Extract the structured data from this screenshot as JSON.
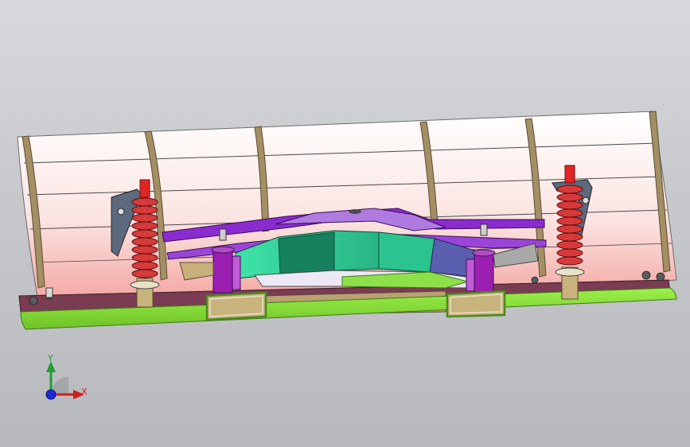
{
  "scene": {
    "colors": {
      "background_top": "#d7d9dd",
      "background_bottom": "#b7b9bd",
      "blade_top": "#ffffff",
      "blade_bottom": "#f4aaa7",
      "frame_tan": "#a48f64",
      "green_base": "#88e23a",
      "purple": "#8a2bcf",
      "teal": "#35d49d",
      "dark_teal": "#168a67",
      "slate_blue": "#5a5fb0",
      "spring_red": "#d63a3a",
      "cap_red": "#e02525"
    },
    "parts": [
      "blade-plate",
      "rib-frame",
      "base-rail",
      "left-spring-assembly",
      "right-spring-assembly",
      "center-pivot-mount",
      "lift-handle-left",
      "lift-handle-right"
    ]
  },
  "triad": {
    "x_label": "X",
    "y_label": "Y",
    "x_color": "#d11f1f",
    "y_color": "#1f9e2f",
    "z_color": "#1c2bd6"
  }
}
